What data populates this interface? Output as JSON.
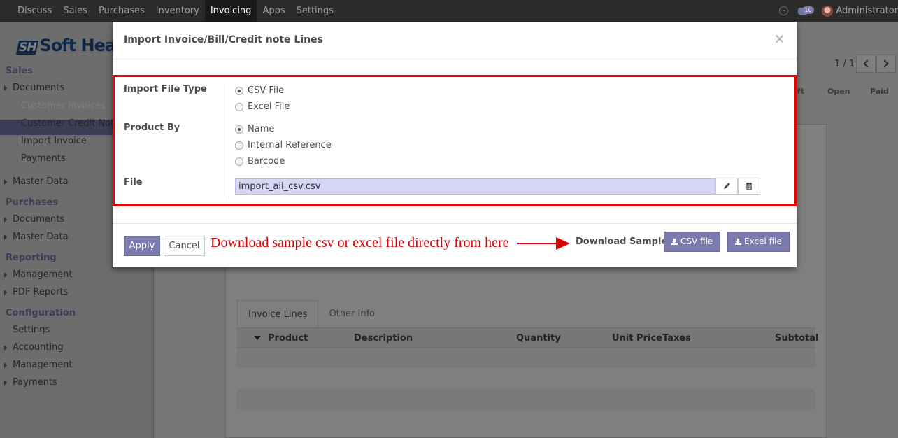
{
  "navbar": {
    "items": [
      "Discuss",
      "Sales",
      "Purchases",
      "Inventory",
      "Invoicing",
      "Apps",
      "Settings"
    ],
    "active": "Invoicing",
    "chat_count": "10",
    "user": "Administrator"
  },
  "sidebar": {
    "logo_mark": "SH",
    "logo_text": "Soft Hea",
    "sales_section": "Sales",
    "sales_items": [
      "Documents",
      "Customer Invoices",
      "Customer Credit Notes",
      "Import Invoice",
      "Payments",
      "Master Data"
    ],
    "purchases_section": "Purchases",
    "purchases_items": [
      "Documents",
      "Master Data"
    ],
    "reporting_section": "Reporting",
    "reporting_items": [
      "Management",
      "PDF Reports"
    ],
    "configuration_section": "Configuration",
    "configuration_items": [
      "Settings",
      "Accounting",
      "Management",
      "Payments"
    ]
  },
  "background": {
    "pager": "1 / 1",
    "status_steps": [
      "ft",
      "Open",
      "Paid"
    ],
    "tabs": [
      "Invoice Lines",
      "Other Info"
    ],
    "table_headers": [
      "Product",
      "Description",
      "Quantity",
      "Unit Price",
      "Taxes",
      "Subtotal"
    ]
  },
  "modal": {
    "title": "Import Invoice/Bill/Credit note Lines",
    "close_label": "×",
    "import_file_type_label": "Import File Type",
    "file_types": [
      "CSV File",
      "Excel File"
    ],
    "selected_file_type": "CSV File",
    "product_by_label": "Product By",
    "product_options": [
      "Name",
      "Internal Reference",
      "Barcode"
    ],
    "selected_product_option": "Name",
    "file_label": "File",
    "file_value": "import_ail_csv.csv",
    "apply_label": "Apply",
    "cancel_label": "Cancel",
    "annotation": "Download sample csv or excel file directly from here",
    "download_label": "Download Sample:",
    "csv_button": "CSV file",
    "excel_button": "Excel file"
  },
  "colors": {
    "brand": "#7c7bad",
    "highlight_border": "#ee0000",
    "annotation": "#dd0000"
  }
}
